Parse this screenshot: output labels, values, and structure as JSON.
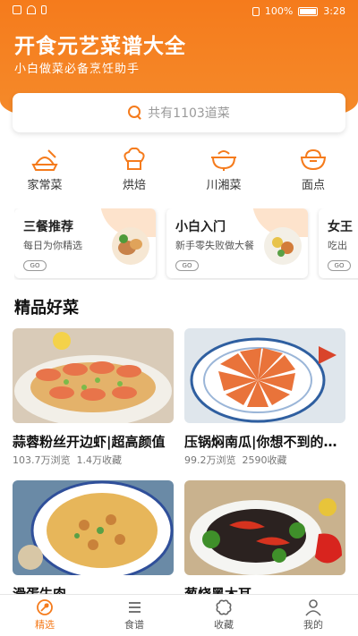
{
  "status_bar": {
    "battery": "100%",
    "time": "3:28"
  },
  "header": {
    "title": "开食元艺菜谱大全",
    "subtitle": "小白做菜必备烹饪助手"
  },
  "search": {
    "placeholder": "共有1103道菜",
    "icon": "search-icon"
  },
  "categories": [
    {
      "label": "家常菜",
      "icon": "home-dish-icon"
    },
    {
      "label": "烘焙",
      "icon": "chef-hat-icon"
    },
    {
      "label": "川湘菜",
      "icon": "hotpot-icon"
    },
    {
      "label": "面点",
      "icon": "noodle-bowl-icon"
    }
  ],
  "feature_cards": [
    {
      "title": "三餐推荐",
      "desc": "每日为你精选",
      "go": "GO"
    },
    {
      "title": "小白入门",
      "desc": "新手零失败做大餐",
      "go": "GO"
    },
    {
      "title": "女王",
      "desc": "吃出",
      "go": "GO"
    }
  ],
  "section": {
    "title": "精品好菜"
  },
  "recipes": [
    {
      "name": "蒜蓉粉丝开边虾|超高颜值",
      "views": "103.7万浏览",
      "favs": "1.4万收藏"
    },
    {
      "name": "压锅焖南瓜|你想不到的美味",
      "views": "99.2万浏览",
      "favs": "2590收藏"
    },
    {
      "name": "滑蛋牛肉",
      "views": "",
      "favs": ""
    },
    {
      "name": "葱烧黑木耳",
      "views": "",
      "favs": ""
    }
  ],
  "tabs": [
    {
      "label": "精选",
      "icon": "featured-icon",
      "active": true
    },
    {
      "label": "食谱",
      "icon": "list-icon",
      "active": false
    },
    {
      "label": "收藏",
      "icon": "favorite-icon",
      "active": false
    },
    {
      "label": "我的",
      "icon": "profile-icon",
      "active": false
    }
  ],
  "colors": {
    "accent": "#f57b1c",
    "card_deco": "#fde3cc"
  }
}
